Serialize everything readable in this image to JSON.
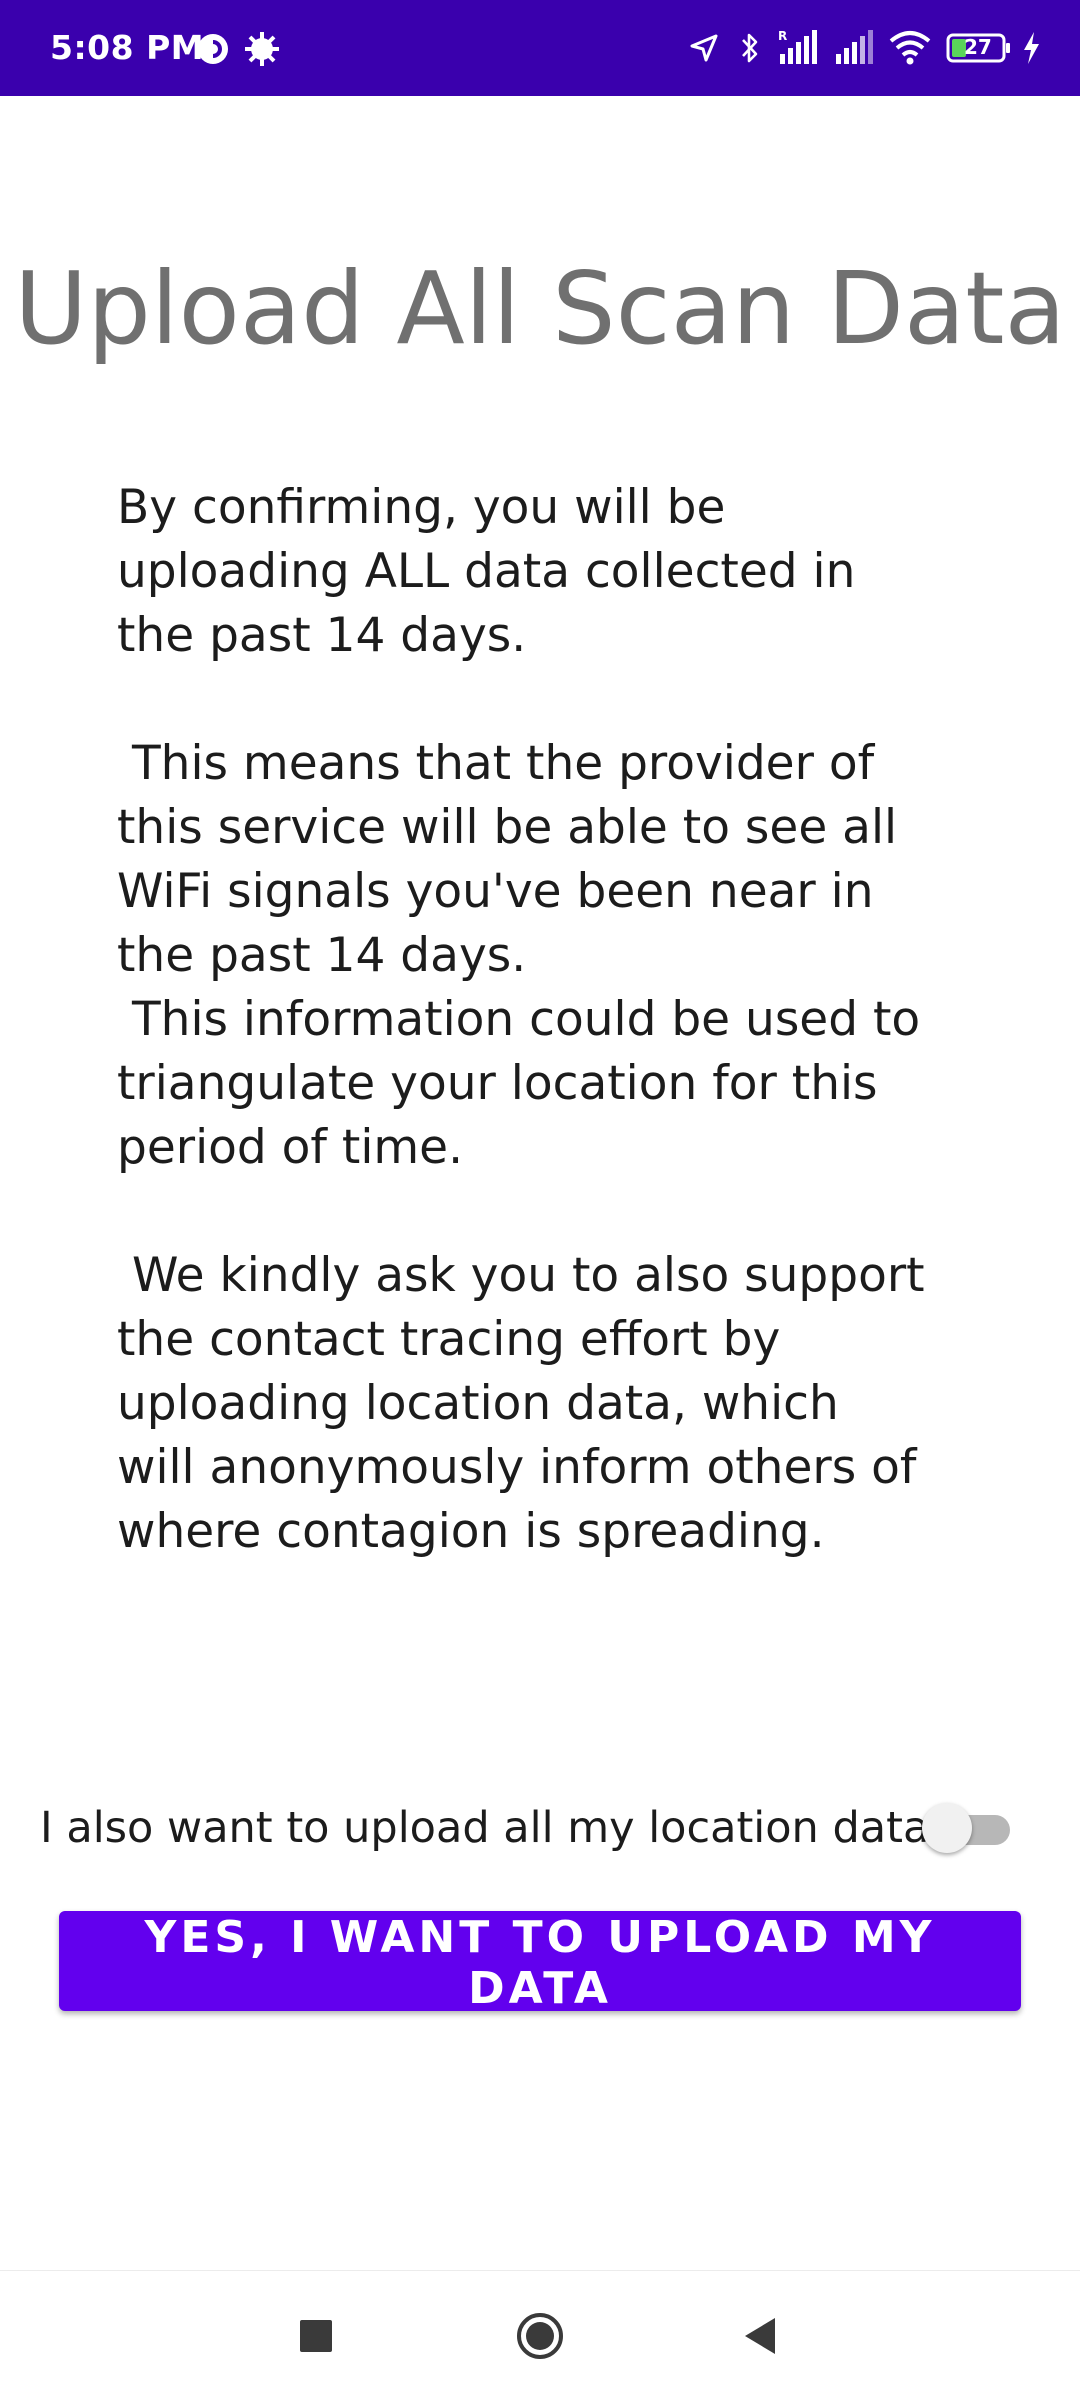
{
  "status_bar": {
    "time": "5:08 PM",
    "battery_level": "27",
    "icons": [
      "data-saver-icon",
      "settings-gear-icon",
      "location-arrow-icon",
      "bluetooth-icon",
      "signal-roaming-icon",
      "signal-icon",
      "wifi-icon",
      "battery-icon",
      "charging-bolt-icon"
    ]
  },
  "page": {
    "title": "Upload All Scan Data",
    "paragraphs": {
      "p1_line1": "By confirming, you will be",
      "p1_line2": "uploading ALL data collected in",
      "p1_line3": "the past 14 days.",
      "p2_line1": " This means that the provider of",
      "p2_line2": "this service will be able to see all",
      "p2_line3": "WiFi signals you've been near in",
      "p2_line4": "the past 14 days.",
      "p3_line1": " This information could be used to",
      "p3_line2": "triangulate your location for this",
      "p3_line3": "period of time.",
      "p4_line1": " We kindly ask you to also support",
      "p4_line2": "the contact tracing effort by",
      "p4_line3": "uploading location data, which",
      "p4_line4": "will anonymously inform others of",
      "p4_line5": "where contagion is spreading."
    },
    "location_toggle": {
      "label": "I also want to upload all my location data",
      "checked": false
    },
    "confirm_button_label": "YES, I WANT TO UPLOAD MY DATA"
  },
  "nav_bar": {
    "icons": [
      "recents-square-icon",
      "home-circle-icon",
      "back-triangle-icon"
    ]
  },
  "colors": {
    "status_bar": "#3a00ad",
    "primary": "#6200ee",
    "title_text": "#707070",
    "body_text": "#1c1c1c"
  }
}
